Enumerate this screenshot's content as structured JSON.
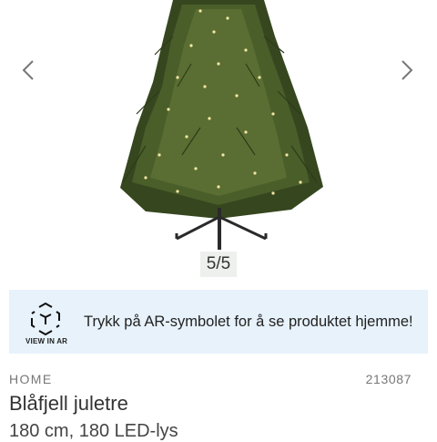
{
  "gallery": {
    "counter": "5/5",
    "prev_icon": "chevron-left-icon",
    "next_icon": "chevron-right-icon",
    "image": "christmas-tree-with-led-lights"
  },
  "ar_banner": {
    "icon": "ar-cube-icon",
    "caption": "VIEW IN AR",
    "text": "Trykk på AR-symbolet for å se produktet hjemme!",
    "background": "#e7f2fb"
  },
  "product": {
    "brand": "HOME",
    "sku": "213087",
    "title": "Blåfjell juletre",
    "subtitle": "180 cm, 180 LED-lys"
  }
}
